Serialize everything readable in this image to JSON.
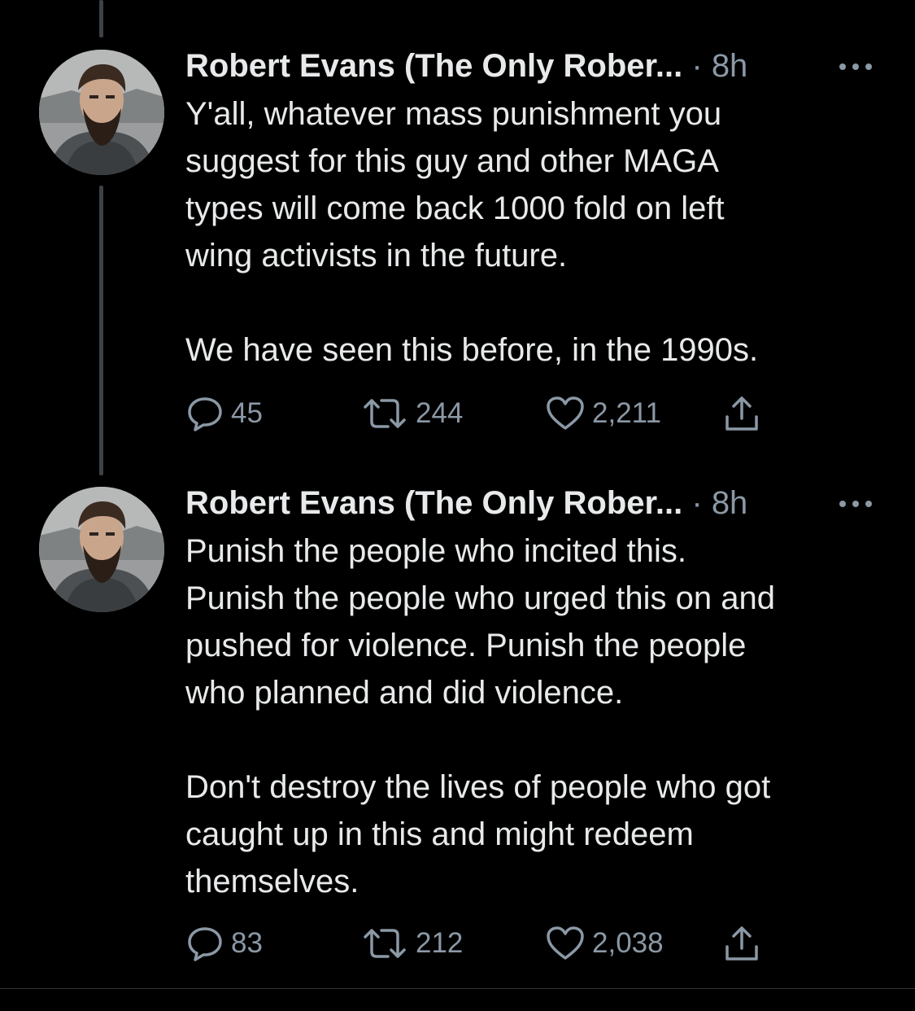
{
  "colors": {
    "background": "#000000",
    "text": "#e7e9ea",
    "muted": "#8b98a5",
    "thread_line": "#3d4246"
  },
  "tweets": [
    {
      "author": "Robert Evans (The Only Rober...",
      "separator": "·",
      "time": "8h",
      "text": "Y'all, whatever mass punishment you\nsuggest for this guy and other MAGA\ntypes will come back 1000 fold on left\nwing activists in the future.\n\nWe have seen this before, in the 1990s.",
      "replies": "45",
      "retweets": "244",
      "likes": "2,211",
      "icons": [
        "reply-icon",
        "retweet-icon",
        "like-icon",
        "share-icon",
        "more-icon"
      ]
    },
    {
      "author": "Robert Evans (The Only Rober...",
      "separator": "·",
      "time": "8h",
      "text": "Punish the people who incited this.\nPunish the people who urged this on and\npushed for violence. Punish the people\nwho planned and did violence.\n\nDon't destroy the lives of people who got\ncaught up in this and might redeem\nthemselves.",
      "replies": "83",
      "retweets": "212",
      "likes": "2,038",
      "icons": [
        "reply-icon",
        "retweet-icon",
        "like-icon",
        "share-icon",
        "more-icon"
      ]
    }
  ]
}
